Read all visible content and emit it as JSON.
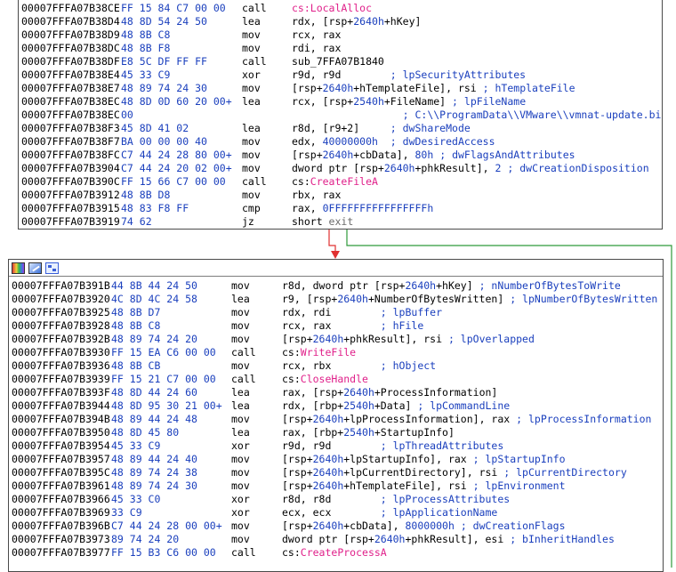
{
  "colors": {
    "bytes": "#1a3fbd",
    "comment": "#1a3fbd",
    "func": "#e0208a",
    "label": "#6b6b6b",
    "edge_true": "#e03030",
    "edge_false": "#2e9a3a",
    "edge_down": "#2a5fd8"
  },
  "block1": {
    "rows": [
      {
        "addr": "00007FFFA07B38CE",
        "bytes": "FF 15 84 C7 00 00",
        "mn": "call",
        "parts": [
          [
            "func",
            "cs:LocalAlloc"
          ]
        ]
      },
      {
        "addr": "00007FFFA07B38D4",
        "bytes": "48 8D 54 24 50",
        "mn": "lea",
        "parts": [
          [
            "t",
            "rdx, [rsp+"
          ],
          [
            "num",
            "2640h"
          ],
          [
            "t",
            "+hKey]"
          ]
        ]
      },
      {
        "addr": "00007FFFA07B38D9",
        "bytes": "48 8B C8",
        "mn": "mov",
        "parts": [
          [
            "t",
            "rcx, rax"
          ]
        ]
      },
      {
        "addr": "00007FFFA07B38DC",
        "bytes": "48 8B F8",
        "mn": "mov",
        "parts": [
          [
            "t",
            "rdi, rax"
          ]
        ]
      },
      {
        "addr": "00007FFFA07B38DF",
        "bytes": "E8 5C DF FF FF",
        "mn": "call",
        "parts": [
          [
            "t",
            "sub_7FFA07B1840"
          ]
        ]
      },
      {
        "addr": "00007FFFA07B38E4",
        "bytes": "45 33 C9",
        "mn": "xor",
        "parts": [
          [
            "t",
            "r9d, r9d        "
          ],
          [
            "cmt",
            "; lpSecurityAttributes"
          ]
        ]
      },
      {
        "addr": "00007FFFA07B38E7",
        "bytes": "48 89 74 24 30",
        "mn": "mov",
        "parts": [
          [
            "t",
            "[rsp+"
          ],
          [
            "num",
            "2640h"
          ],
          [
            "t",
            "+hTemplateFile], rsi "
          ],
          [
            "cmt",
            "; hTemplateFile"
          ]
        ]
      },
      {
        "addr": "00007FFFA07B38EC",
        "bytes": "48 8D 0D 60 20 00+",
        "mn": "lea",
        "parts": [
          [
            "t",
            "rcx, [rsp+"
          ],
          [
            "num",
            "2540h"
          ],
          [
            "t",
            "+FileName] "
          ],
          [
            "cmt",
            "; lpFileName"
          ]
        ]
      },
      {
        "addr": "00007FFFA07B38EC",
        "bytes": "00",
        "mn": "",
        "parts": [
          [
            "cmt",
            "                  ; C:\\\\ProgramData\\\\VMware\\\\vmnat-update.bin"
          ]
        ]
      },
      {
        "addr": "00007FFFA07B38F3",
        "bytes": "45 8D 41 02",
        "mn": "lea",
        "parts": [
          [
            "t",
            "r8d, [r9+2]     "
          ],
          [
            "cmt",
            "; dwShareMode"
          ]
        ]
      },
      {
        "addr": "00007FFFA07B38F7",
        "bytes": "BA 00 00 00 40",
        "mn": "mov",
        "parts": [
          [
            "t",
            "edx, "
          ],
          [
            "num",
            "40000000h"
          ],
          [
            "t",
            "  "
          ],
          [
            "cmt",
            "; dwDesiredAccess"
          ]
        ]
      },
      {
        "addr": "00007FFFA07B38FC",
        "bytes": "C7 44 24 28 80 00+",
        "mn": "mov",
        "parts": [
          [
            "t",
            "[rsp+"
          ],
          [
            "num",
            "2640h"
          ],
          [
            "t",
            "+cbData], "
          ],
          [
            "num",
            "80h"
          ],
          [
            "t",
            " "
          ],
          [
            "cmt",
            "; dwFlagsAndAttributes"
          ]
        ]
      },
      {
        "addr": "00007FFFA07B3904",
        "bytes": "C7 44 24 20 02 00+",
        "mn": "mov",
        "parts": [
          [
            "t",
            "dword ptr [rsp+"
          ],
          [
            "num",
            "2640h"
          ],
          [
            "t",
            "+phkResult], "
          ],
          [
            "num",
            "2"
          ],
          [
            "t",
            " "
          ],
          [
            "cmt",
            "; dwCreationDisposition"
          ]
        ]
      },
      {
        "addr": "00007FFFA07B390C",
        "bytes": "FF 15 66 C7 00 00",
        "mn": "call",
        "parts": [
          [
            "t",
            "cs:"
          ],
          [
            "func",
            "CreateFileA"
          ]
        ]
      },
      {
        "addr": "00007FFFA07B3912",
        "bytes": "48 8B D8",
        "mn": "mov",
        "parts": [
          [
            "t",
            "rbx, rax"
          ]
        ]
      },
      {
        "addr": "00007FFFA07B3915",
        "bytes": "48 83 F8 FF",
        "mn": "cmp",
        "parts": [
          [
            "t",
            "rax, "
          ],
          [
            "num",
            "0FFFFFFFFFFFFFFFFh"
          ]
        ]
      },
      {
        "addr": "00007FFFA07B3919",
        "bytes": "74 62",
        "mn": "jz",
        "parts": [
          [
            "t",
            "short "
          ],
          [
            "lbl",
            "exit"
          ]
        ]
      }
    ]
  },
  "block2": {
    "rows": [
      {
        "addr": "00007FFFA07B391B",
        "bytes": "44 8B 44 24 50",
        "mn": "mov",
        "parts": [
          [
            "t",
            "r8d, dword ptr [rsp+"
          ],
          [
            "num",
            "2640h"
          ],
          [
            "t",
            "+hKey] "
          ],
          [
            "cmt",
            "; nNumberOfBytesToWrite"
          ]
        ]
      },
      {
        "addr": "00007FFFA07B3920",
        "bytes": "4C 8D 4C 24 58",
        "mn": "lea",
        "parts": [
          [
            "t",
            "r9, [rsp+"
          ],
          [
            "num",
            "2640h"
          ],
          [
            "t",
            "+NumberOfBytesWritten] "
          ],
          [
            "cmt",
            "; lpNumberOfBytesWritten"
          ]
        ]
      },
      {
        "addr": "00007FFFA07B3925",
        "bytes": "48 8B D7",
        "mn": "mov",
        "parts": [
          [
            "t",
            "rdx, rdi        "
          ],
          [
            "cmt",
            "; lpBuffer"
          ]
        ]
      },
      {
        "addr": "00007FFFA07B3928",
        "bytes": "48 8B C8",
        "mn": "mov",
        "parts": [
          [
            "t",
            "rcx, rax        "
          ],
          [
            "cmt",
            "; hFile"
          ]
        ]
      },
      {
        "addr": "00007FFFA07B392B",
        "bytes": "48 89 74 24 20",
        "mn": "mov",
        "parts": [
          [
            "t",
            "[rsp+"
          ],
          [
            "num",
            "2640h"
          ],
          [
            "t",
            "+phkResult], rsi "
          ],
          [
            "cmt",
            "; lpOverlapped"
          ]
        ]
      },
      {
        "addr": "00007FFFA07B3930",
        "bytes": "FF 15 EA C6 00 00",
        "mn": "call",
        "parts": [
          [
            "t",
            "cs:"
          ],
          [
            "func",
            "WriteFile"
          ]
        ]
      },
      {
        "addr": "00007FFFA07B3936",
        "bytes": "48 8B CB",
        "mn": "mov",
        "parts": [
          [
            "t",
            "rcx, rbx        "
          ],
          [
            "cmt",
            "; hObject"
          ]
        ]
      },
      {
        "addr": "00007FFFA07B3939",
        "bytes": "FF 15 21 C7 00 00",
        "mn": "call",
        "parts": [
          [
            "t",
            "cs:"
          ],
          [
            "func",
            "CloseHandle"
          ]
        ]
      },
      {
        "addr": "00007FFFA07B393F",
        "bytes": "48 8D 44 24 60",
        "mn": "lea",
        "parts": [
          [
            "t",
            "rax, [rsp+"
          ],
          [
            "num",
            "2640h"
          ],
          [
            "t",
            "+ProcessInformation]"
          ]
        ]
      },
      {
        "addr": "00007FFFA07B3944",
        "bytes": "48 8D 95 30 21 00+",
        "mn": "lea",
        "parts": [
          [
            "t",
            "rdx, [rbp+"
          ],
          [
            "num",
            "2540h"
          ],
          [
            "t",
            "+Data] "
          ],
          [
            "cmt",
            "; lpCommandLine"
          ]
        ]
      },
      {
        "addr": "00007FFFA07B394B",
        "bytes": "48 89 44 24 48",
        "mn": "mov",
        "parts": [
          [
            "t",
            "[rsp+"
          ],
          [
            "num",
            "2640h"
          ],
          [
            "t",
            "+lpProcessInformation], rax "
          ],
          [
            "cmt",
            "; lpProcessInformation"
          ]
        ]
      },
      {
        "addr": "00007FFFA07B3950",
        "bytes": "48 8D 45 80",
        "mn": "lea",
        "parts": [
          [
            "t",
            "rax, [rbp+"
          ],
          [
            "num",
            "2540h"
          ],
          [
            "t",
            "+StartupInfo]"
          ]
        ]
      },
      {
        "addr": "00007FFFA07B3954",
        "bytes": "45 33 C9",
        "mn": "xor",
        "parts": [
          [
            "t",
            "r9d, r9d        "
          ],
          [
            "cmt",
            "; lpThreadAttributes"
          ]
        ]
      },
      {
        "addr": "00007FFFA07B3957",
        "bytes": "48 89 44 24 40",
        "mn": "mov",
        "parts": [
          [
            "t",
            "[rsp+"
          ],
          [
            "num",
            "2640h"
          ],
          [
            "t",
            "+lpStartupInfo], rax "
          ],
          [
            "cmt",
            "; lpStartupInfo"
          ]
        ]
      },
      {
        "addr": "00007FFFA07B395C",
        "bytes": "48 89 74 24 38",
        "mn": "mov",
        "parts": [
          [
            "t",
            "[rsp+"
          ],
          [
            "num",
            "2640h"
          ],
          [
            "t",
            "+lpCurrentDirectory], rsi "
          ],
          [
            "cmt",
            "; lpCurrentDirectory"
          ]
        ]
      },
      {
        "addr": "00007FFFA07B3961",
        "bytes": "48 89 74 24 30",
        "mn": "mov",
        "parts": [
          [
            "t",
            "[rsp+"
          ],
          [
            "num",
            "2640h"
          ],
          [
            "t",
            "+hTemplateFile], rsi "
          ],
          [
            "cmt",
            "; lpEnvironment"
          ]
        ]
      },
      {
        "addr": "00007FFFA07B3966",
        "bytes": "45 33 C0",
        "mn": "xor",
        "parts": [
          [
            "t",
            "r8d, r8d        "
          ],
          [
            "cmt",
            "; lpProcessAttributes"
          ]
        ]
      },
      {
        "addr": "00007FFFA07B3969",
        "bytes": "33 C9",
        "mn": "xor",
        "parts": [
          [
            "t",
            "ecx, ecx        "
          ],
          [
            "cmt",
            "; lpApplicationName"
          ]
        ]
      },
      {
        "addr": "00007FFFA07B396B",
        "bytes": "C7 44 24 28 00 00+",
        "mn": "mov",
        "parts": [
          [
            "t",
            "[rsp+"
          ],
          [
            "num",
            "2640h"
          ],
          [
            "t",
            "+cbData], "
          ],
          [
            "num",
            "8000000h"
          ],
          [
            "t",
            " "
          ],
          [
            "cmt",
            "; dwCreationFlags"
          ]
        ]
      },
      {
        "addr": "00007FFFA07B3973",
        "bytes": "89 74 24 20",
        "mn": "mov",
        "parts": [
          [
            "t",
            "dword ptr [rsp+"
          ],
          [
            "num",
            "2640h"
          ],
          [
            "t",
            "+phkResult], esi "
          ],
          [
            "cmt",
            "; bInheritHandles"
          ]
        ]
      },
      {
        "addr": "00007FFFA07B3977",
        "bytes": "FF 15 B3 C6 00 00",
        "mn": "call",
        "parts": [
          [
            "t",
            "cs:"
          ],
          [
            "func",
            "CreateProcessA"
          ]
        ]
      }
    ]
  }
}
